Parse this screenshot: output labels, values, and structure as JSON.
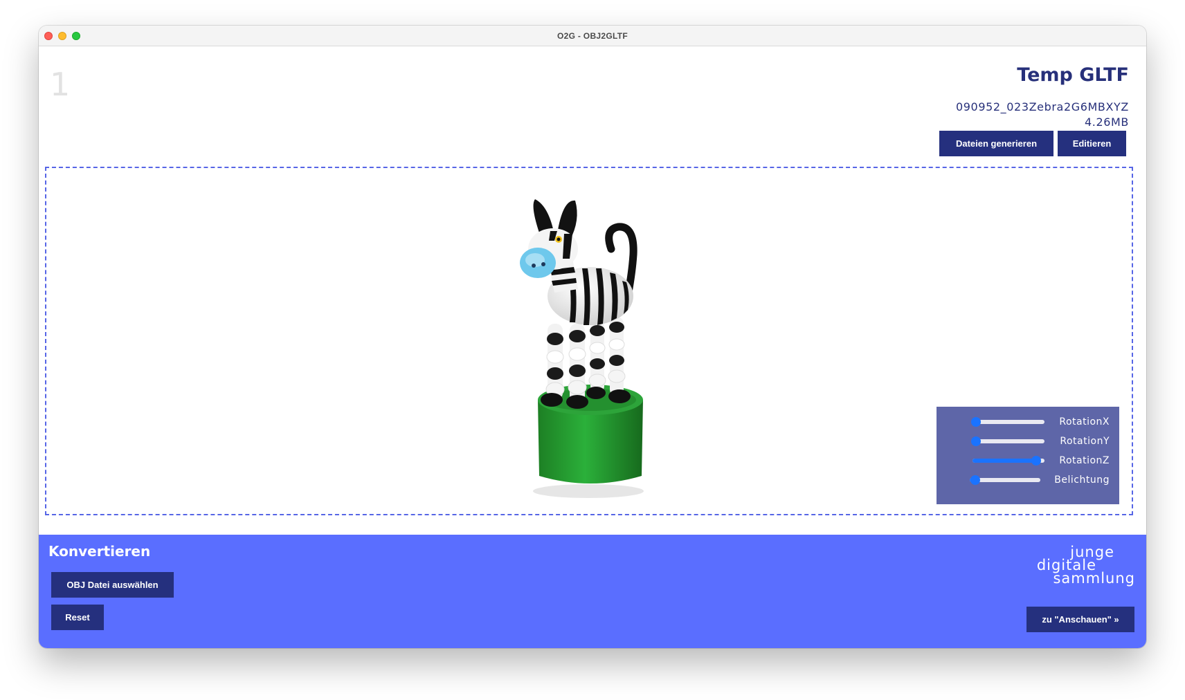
{
  "window": {
    "title": "O2G - OBJ2GLTF"
  },
  "header": {
    "step_number": "1",
    "title": "Temp GLTF",
    "file_name": "090952_023Zebra2G6MBXYZ",
    "file_size": "4.26MB",
    "generate_label": "Dateien generieren",
    "edit_label": "Editieren"
  },
  "viewer": {
    "model": "zebra-toy-model",
    "controls": [
      {
        "label": "RotationX",
        "value": 0.05
      },
      {
        "label": "RotationY",
        "value": 0.05
      },
      {
        "label": "RotationZ",
        "value": 0.88
      },
      {
        "label": "Belichtung",
        "value": 0.08
      }
    ]
  },
  "footer": {
    "heading": "Konvertieren",
    "select_label": "OBJ Datei auswählen",
    "reset_label": "Reset",
    "view_label": "zu \"Anschauen\" »",
    "logo_lines": [
      "junge",
      "digitale",
      "sammlung"
    ]
  },
  "colors": {
    "primary_dark": "#25307e",
    "footer_blue": "#5a6eff",
    "slider_accent": "#1a73ff",
    "controls_bg": "#5e66a8"
  }
}
